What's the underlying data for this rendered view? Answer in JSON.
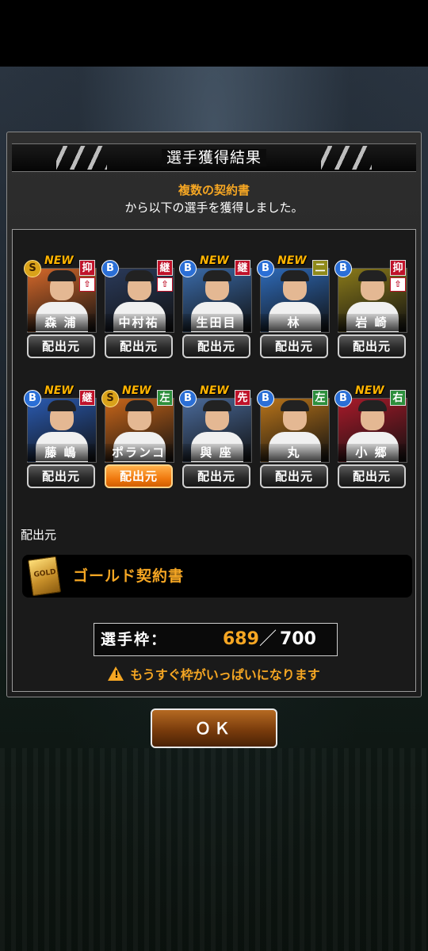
{
  "dialog": {
    "title": "選手獲得結果",
    "message_highlight": "複数の契約書",
    "message_rest": "から以下の選手を獲得しました。"
  },
  "players": [
    {
      "name": "森 浦",
      "rank": "S",
      "is_new": true,
      "position": "抑",
      "pos_color": "red",
      "has_up": true,
      "bg": "#d4682a"
    },
    {
      "name": "中村祐",
      "rank": "B",
      "is_new": false,
      "position": "継",
      "pos_color": "red",
      "has_up": true,
      "bg": "#2a3a5a"
    },
    {
      "name": "生田目",
      "rank": "B",
      "is_new": true,
      "position": "継",
      "pos_color": "red",
      "has_up": false,
      "bg": "#3a6aa8"
    },
    {
      "name": "林",
      "rank": "B",
      "is_new": true,
      "position": "二",
      "pos_color": "olive",
      "has_up": false,
      "bg": "#2e6ab8"
    },
    {
      "name": "岩 崎",
      "rank": "B",
      "is_new": false,
      "position": "抑",
      "pos_color": "red",
      "has_up": true,
      "bg": "#8a7a1a"
    },
    {
      "name": "藤 嶋",
      "rank": "B",
      "is_new": true,
      "position": "継",
      "pos_color": "red",
      "has_up": false,
      "bg": "#2a5ab0"
    },
    {
      "name": "ポランコ",
      "rank": "S",
      "is_new": true,
      "position": "左",
      "pos_color": "green",
      "has_up": false,
      "bg": "#c8661a"
    },
    {
      "name": "與 座",
      "rank": "B",
      "is_new": true,
      "position": "先",
      "pos_color": "red",
      "has_up": false,
      "bg": "#4a6a9a"
    },
    {
      "name": "丸",
      "rank": "B",
      "is_new": false,
      "position": "左",
      "pos_color": "green",
      "has_up": false,
      "bg": "#b8741a"
    },
    {
      "name": "小 郷",
      "rank": "B",
      "is_new": true,
      "position": "右",
      "pos_color": "green",
      "has_up": false,
      "bg": "#a81a2a"
    }
  ],
  "labels": {
    "new": "NEW",
    "source_button": "配出元",
    "source_section": "配出元",
    "up_arrow": "⇧"
  },
  "source": {
    "name": "ゴールド契約書",
    "icon_text": "GOLD"
  },
  "slots": {
    "label": "選手枠：",
    "current": "689",
    "separator": "／",
    "max": "700"
  },
  "warning": {
    "text": "もうすぐ枠がいっぱいになります"
  },
  "ok_button": "ＯＫ",
  "colors": {
    "accent_orange": "#f5a623",
    "rank_b": "#2b6fd6",
    "rank_s": "#d9a21a"
  }
}
